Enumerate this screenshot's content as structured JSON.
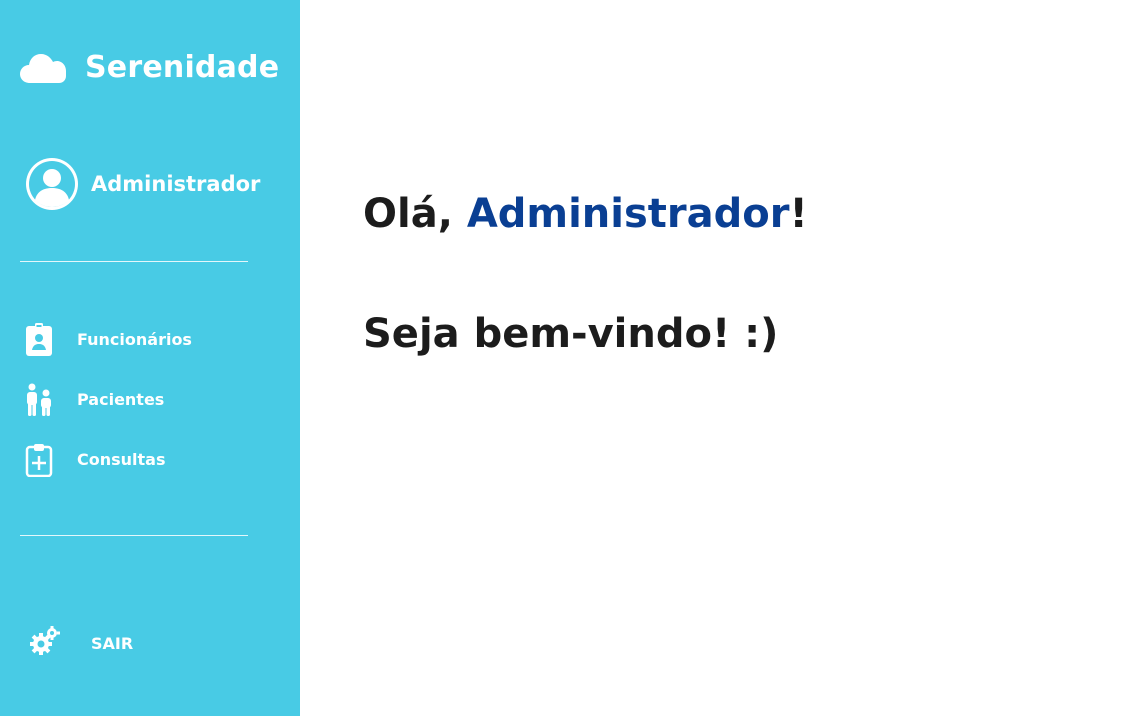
{
  "brand": {
    "title": "Serenidade",
    "icon": "cloud-icon"
  },
  "profile": {
    "name": "Administrador",
    "icon": "user-avatar-icon"
  },
  "nav": {
    "items": [
      {
        "label": "Funcionários",
        "icon": "id-badge-icon"
      },
      {
        "label": "Pacientes",
        "icon": "people-icon"
      },
      {
        "label": "Consultas",
        "icon": "clipboard-plus-icon"
      }
    ]
  },
  "logout": {
    "label": "SAIR",
    "icon": "gear-icon"
  },
  "main": {
    "greeting_prefix": "Olá, ",
    "greeting_name": "Administrador",
    "greeting_suffix": "!",
    "welcome": "Seja bem-vindo! :)"
  },
  "colors": {
    "sidebar": "#48cbe5",
    "accent_text": "#0a3f93",
    "heading_text": "#1c1c1c",
    "background": "#ffffff"
  }
}
